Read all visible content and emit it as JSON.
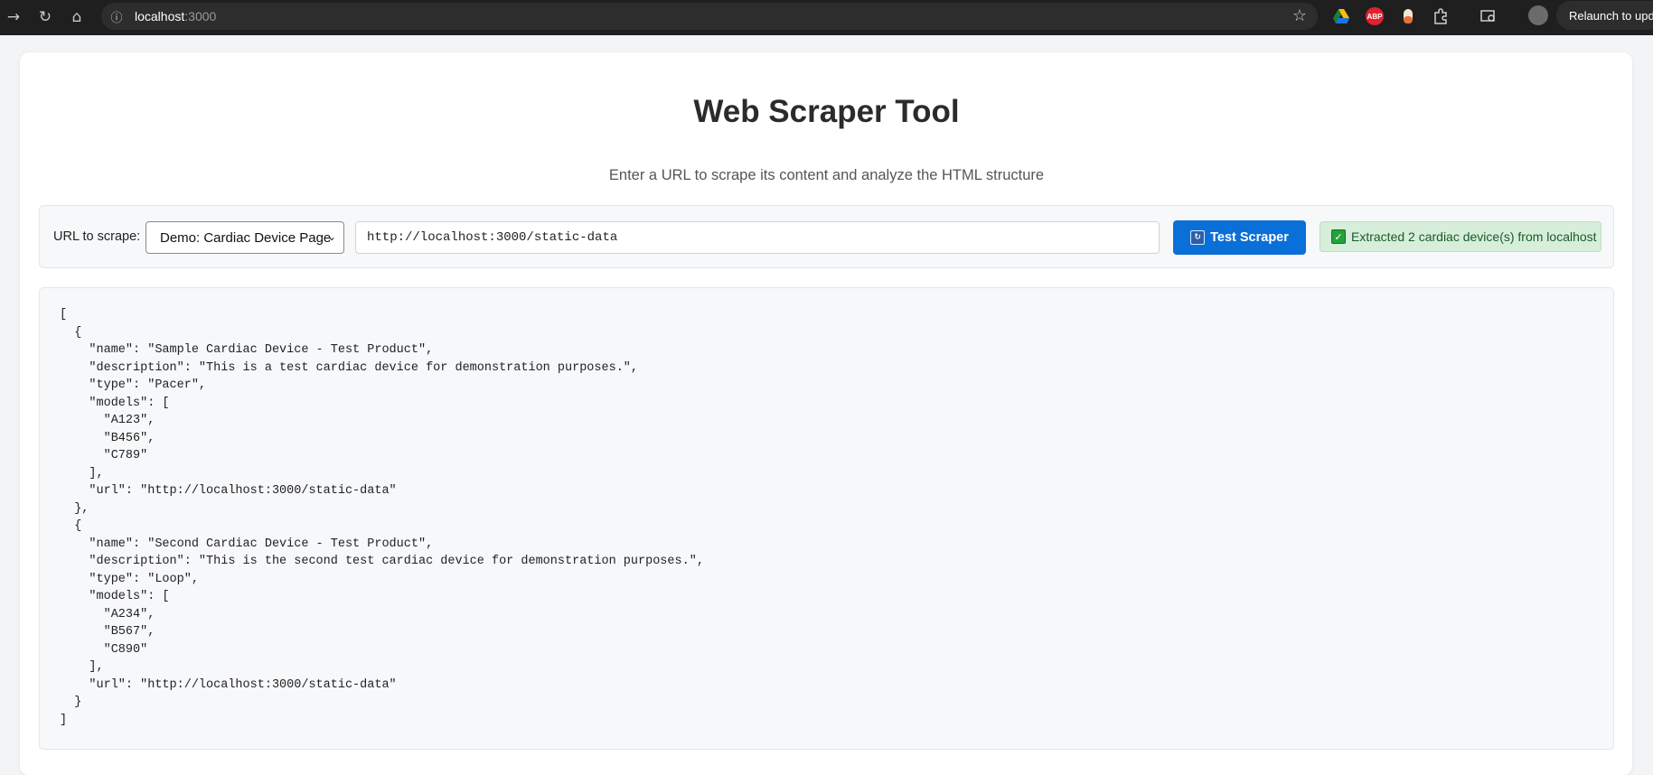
{
  "browser": {
    "address_host": "localhost",
    "address_port": ":3000",
    "relaunch_label": "Relaunch to upda",
    "extensions": [
      "google-drive-icon",
      "abp-icon",
      "extension-pill-icon",
      "puzzle-icon"
    ],
    "ext_abp_label": "ABP"
  },
  "page": {
    "title": "Web Scraper Tool",
    "subtitle": "Enter a URL to scrape its content and analyze the HTML structure"
  },
  "controls": {
    "url_label": "URL to scrape:",
    "select_value": "Demo: Cardiac Device Page",
    "url_value": "http://localhost:3000/static-data",
    "button_label": "Test Scraper",
    "status_text": "Extracted 2 cardiac device(s) from localhost"
  },
  "colors": {
    "accent": "#0a6fd8",
    "success_bg": "#d7eedb",
    "success_text": "#1c5a2a"
  },
  "output": {
    "json_text": "[\n  {\n    \"name\": \"Sample Cardiac Device - Test Product\",\n    \"description\": \"This is a test cardiac device for demonstration purposes.\",\n    \"type\": \"Pacer\",\n    \"models\": [\n      \"A123\",\n      \"B456\",\n      \"C789\"\n    ],\n    \"url\": \"http://localhost:3000/static-data\"\n  },\n  {\n    \"name\": \"Second Cardiac Device - Test Product\",\n    \"description\": \"This is the second test cardiac device for demonstration purposes.\",\n    \"type\": \"Loop\",\n    \"models\": [\n      \"A234\",\n      \"B567\",\n      \"C890\"\n    ],\n    \"url\": \"http://localhost:3000/static-data\"\n  }\n]"
  }
}
